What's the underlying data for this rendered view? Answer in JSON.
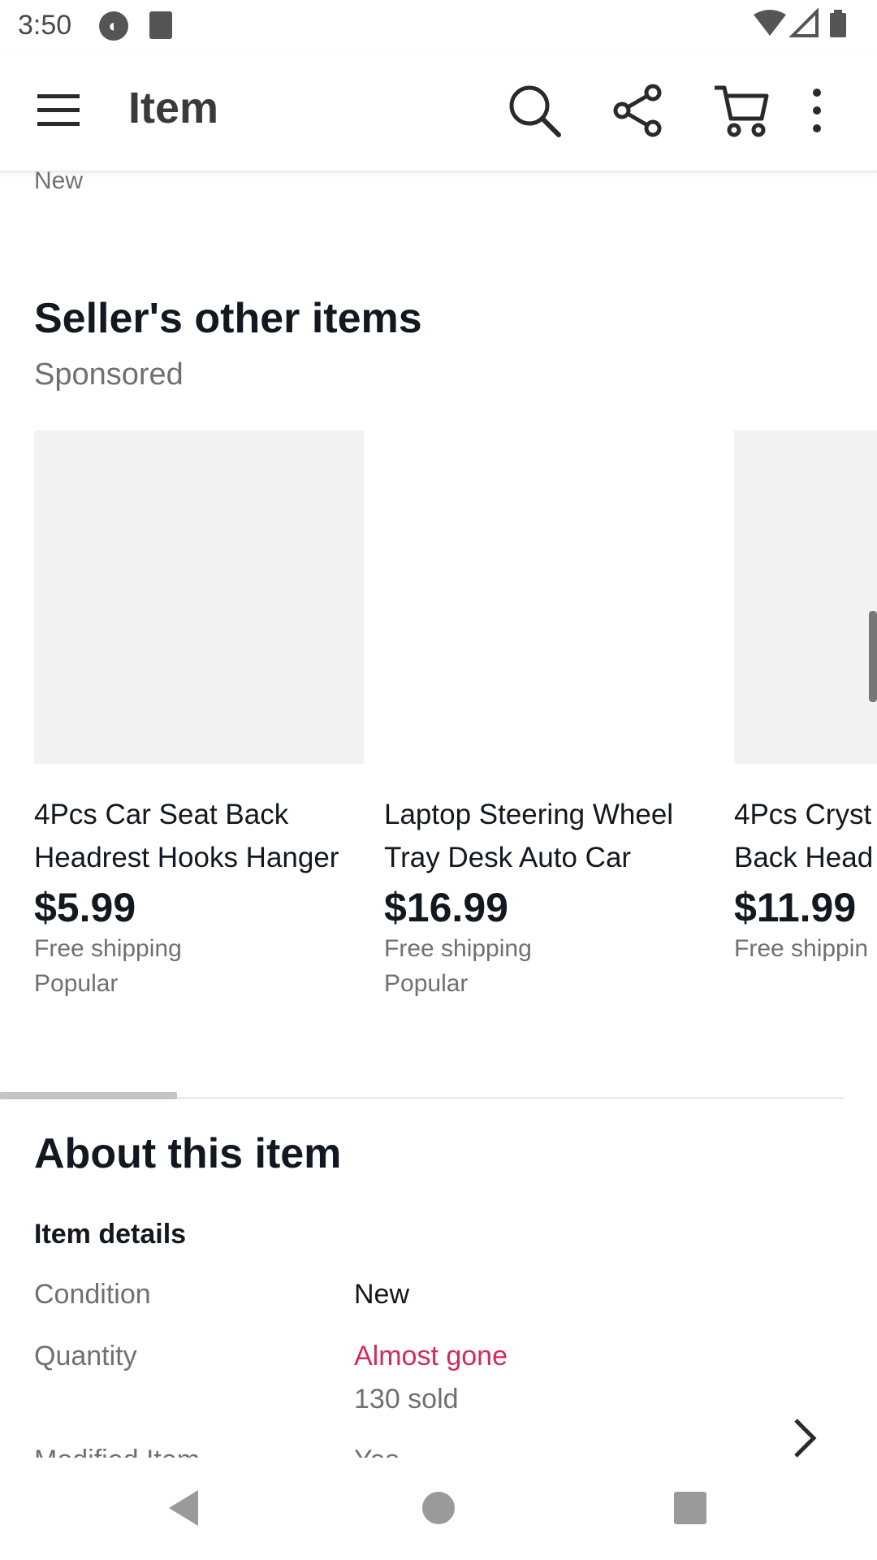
{
  "status_bar": {
    "time": "3:50",
    "left_icons": [
      "shield-circle-icon",
      "sd-card-icon"
    ],
    "right_icons": [
      "wifi-icon",
      "signal-icon",
      "battery-icon"
    ]
  },
  "app_bar": {
    "title": "Item",
    "icons": [
      "menu-icon",
      "search-icon",
      "share-icon",
      "cart-icon",
      "more-vert-icon"
    ]
  },
  "top_cut_text": "New",
  "sellers_items": {
    "title": "Seller's other items",
    "subtitle": "Sponsored",
    "items": [
      {
        "line1": "4Pcs Car Seat Back",
        "line2": "Headrest Hooks Hanger",
        "price": "$5.99",
        "shipping": "Free shipping",
        "tag": "Popular"
      },
      {
        "line1": "Laptop Steering Wheel",
        "line2": "Tray Desk Auto Car",
        "price": "$16.99",
        "shipping": "Free shipping",
        "tag": "Popular"
      },
      {
        "line1": "4Pcs Cryst",
        "line2": "Back Head",
        "price": "$11.99",
        "shipping": "Free shippin",
        "tag": ""
      }
    ]
  },
  "about": {
    "title": "About this item",
    "details_label": "Item details",
    "rows": [
      {
        "label": "Condition",
        "value": "New"
      },
      {
        "label": "Quantity",
        "value": "Almost gone",
        "sub": "130 sold"
      }
    ],
    "cut_row": {
      "label": "Modified Item",
      "value": "Yes"
    }
  },
  "colors": {
    "primary_text": "#111820",
    "secondary_text": "#707070",
    "urgent": "#d12b5a"
  }
}
